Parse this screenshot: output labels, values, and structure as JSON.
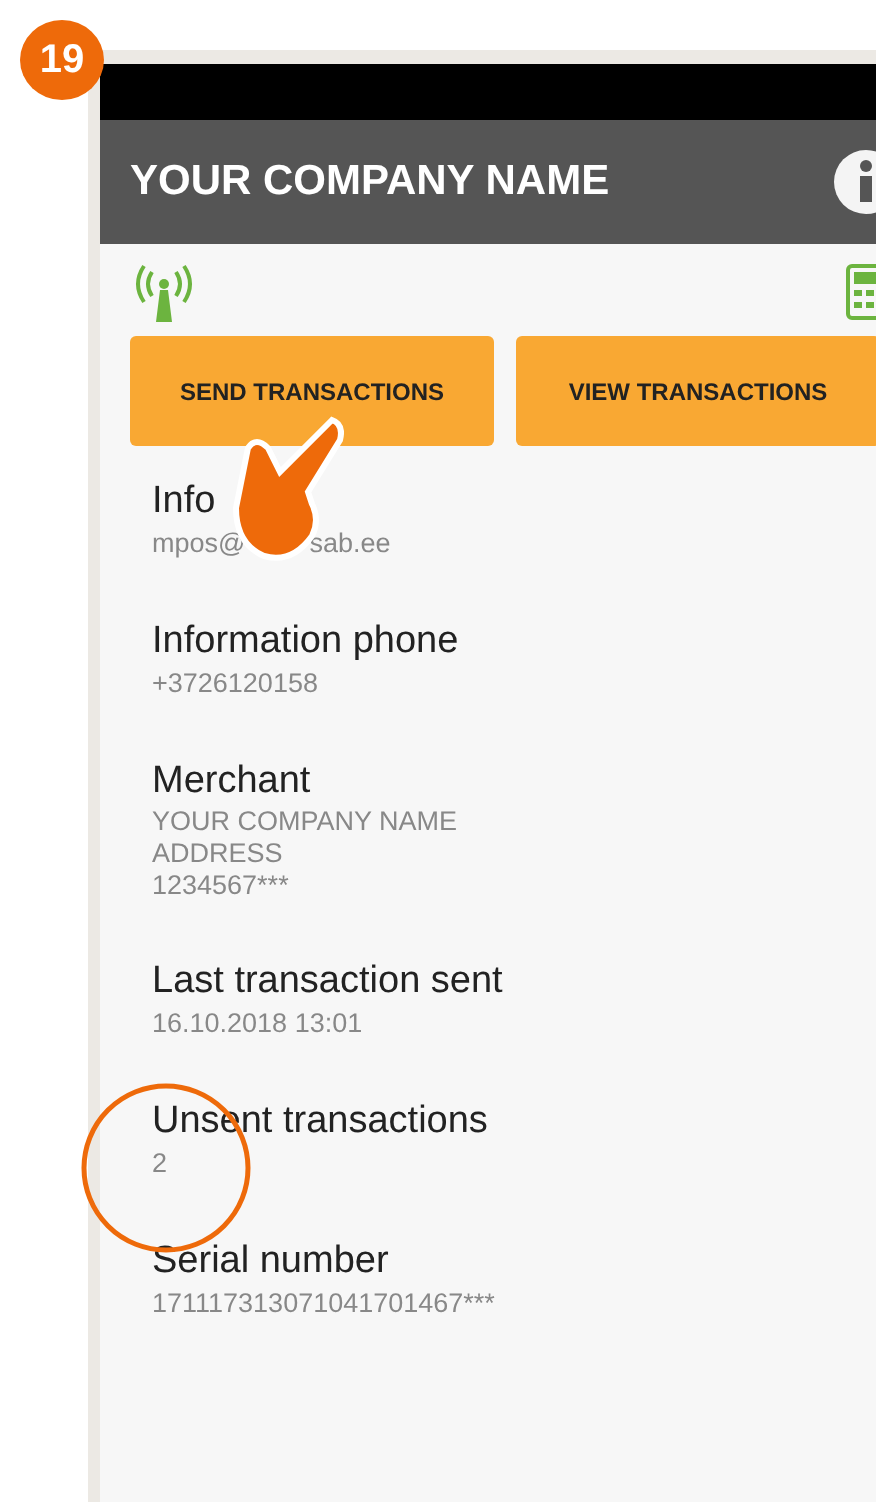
{
  "step_badge": "19",
  "header": {
    "title": "YOUR COMPANY NAME"
  },
  "buttons": [
    {
      "label": "SEND TRANSACTIONS"
    },
    {
      "label": "VIEW TRANSACTIONS"
    }
  ],
  "fields": [
    {
      "label": "Info",
      "lines": [
        [
          "mpos@",
          "sab.ee"
        ]
      ]
    },
    {
      "label": "Information phone",
      "lines": [
        "+3726120158"
      ]
    },
    {
      "label": "Merchant",
      "lines": [
        "YOUR COMPANY NAME",
        "ADDRESS",
        "1234567***"
      ]
    },
    {
      "label": "Last transaction sent",
      "lines": [
        "16.10.2018 13:01"
      ]
    },
    {
      "label": "Unsent transactions",
      "lines": [
        "2"
      ]
    },
    {
      "label": "Serial number",
      "lines": [
        "171117313071041701467***"
      ]
    }
  ]
}
